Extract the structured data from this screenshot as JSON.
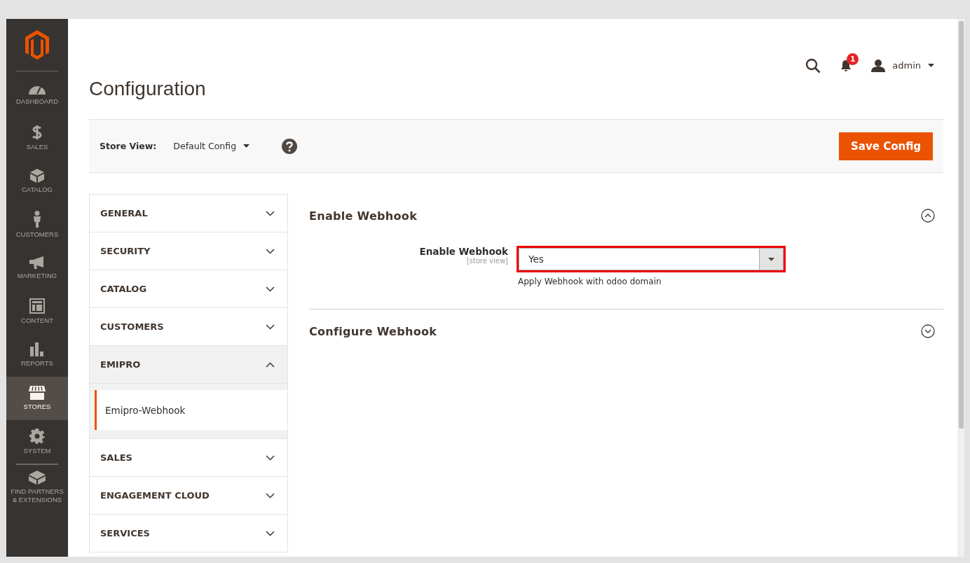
{
  "nav": [
    {
      "kind": "dashboard",
      "label": "DASHBOARD",
      "selected": false
    },
    {
      "kind": "sales",
      "label": "SALES",
      "selected": false
    },
    {
      "kind": "catalog",
      "label": "CATALOG",
      "selected": false
    },
    {
      "kind": "customers",
      "label": "CUSTOMERS",
      "selected": false
    },
    {
      "kind": "marketing",
      "label": "MARKETING",
      "selected": false
    },
    {
      "kind": "content",
      "label": "CONTENT",
      "selected": false
    },
    {
      "kind": "reports",
      "label": "REPORTS",
      "selected": false
    },
    {
      "kind": "stores",
      "label": "STORES",
      "selected": true
    },
    {
      "kind": "system",
      "label": "SYSTEM",
      "selected": false
    },
    {
      "kind": "partners",
      "label": "FIND PARTNERS & EXTENSIONS",
      "selected": false
    }
  ],
  "page_title": "Configuration",
  "header": {
    "notification_count": "1",
    "user": "admin"
  },
  "scope": {
    "label": "Store View:",
    "value": "Default Config"
  },
  "save_button": "Save Config",
  "tabs": [
    {
      "label": "GENERAL",
      "expanded": false
    },
    {
      "label": "SECURITY",
      "expanded": false
    },
    {
      "label": "CATALOG",
      "expanded": false
    },
    {
      "label": "CUSTOMERS",
      "expanded": false
    },
    {
      "label": "EMIPRO",
      "expanded": true,
      "children": [
        {
          "label": "Emipro-Webhook",
          "selected": true
        }
      ]
    },
    {
      "label": "SALES",
      "expanded": false
    },
    {
      "label": "ENGAGEMENT CLOUD",
      "expanded": false
    },
    {
      "label": "SERVICES",
      "expanded": false
    }
  ],
  "sections": [
    {
      "title": "Enable Webhook",
      "expanded": true,
      "fields": [
        {
          "label": "Enable Webhook",
          "scope": "[store view]",
          "value": "Yes",
          "note": "Apply Webhook with odoo domain",
          "highlighted": true
        }
      ]
    },
    {
      "title": "Configure Webhook",
      "expanded": false
    }
  ]
}
